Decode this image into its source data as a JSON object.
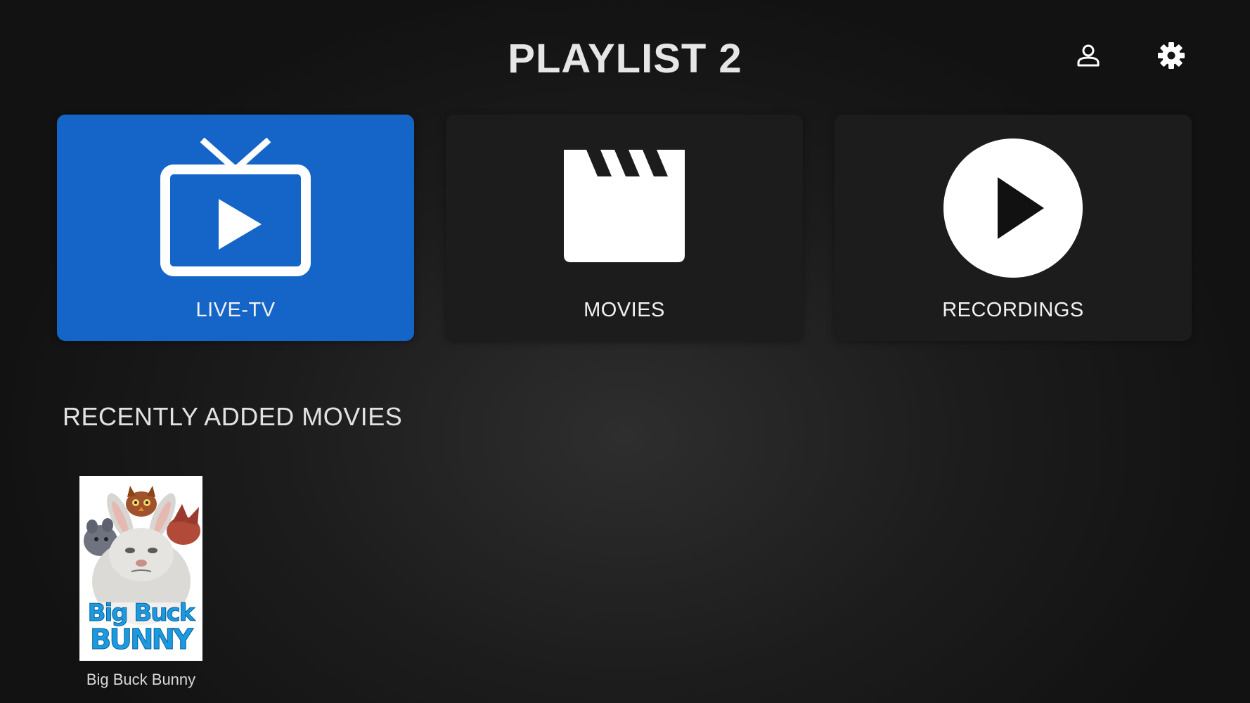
{
  "header": {
    "title": "PLAYLIST 2",
    "icons": [
      "person-icon",
      "gear-icon"
    ]
  },
  "tiles": [
    {
      "label": "LIVE-TV",
      "icon": "tv-icon",
      "selected": true
    },
    {
      "label": "MOVIES",
      "icon": "clapperboard-icon",
      "selected": false
    },
    {
      "label": "RECORDINGS",
      "icon": "play-circle-icon",
      "selected": false
    }
  ],
  "recent": {
    "title": "RECENTLY ADDED MOVIES",
    "items": [
      {
        "title": "Big Buck Bunny",
        "poster_text_line1": "Big Buck",
        "poster_text_line2": "BUNNY"
      }
    ]
  },
  "colors": {
    "accent": "#1565c9",
    "tile_bg": "#1c1c1c",
    "background": "#1c1c1c",
    "poster_text": "#1a9be0"
  }
}
